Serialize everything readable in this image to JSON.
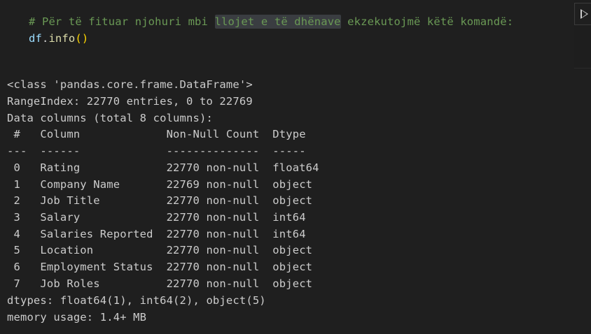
{
  "code_cell": {
    "comment_before": "# Për të fituar njohuri mbi ",
    "comment_highlight": "llojet e të dhënave",
    "comment_after": " ekzekutojmë këtë komandë:",
    "code_var": "df",
    "code_dot": ".",
    "code_fn": "info",
    "code_paren": "()"
  },
  "output_lines": [
    "<class 'pandas.core.frame.DataFrame'>",
    "RangeIndex: 22770 entries, 0 to 22769",
    "Data columns (total 8 columns):",
    " #   Column             Non-Null Count  Dtype  ",
    "---  ------             --------------  -----  ",
    " 0   Rating             22770 non-null  float64",
    " 1   Company Name       22769 non-null  object ",
    " 2   Job Title          22770 non-null  object ",
    " 3   Salary             22770 non-null  int64  ",
    " 4   Salaries Reported  22770 non-null  int64  ",
    " 5   Location           22770 non-null  object ",
    " 6   Employment Status  22770 non-null  object ",
    " 7   Job Roles          22770 non-null  object ",
    "dtypes: float64(1), int64(2), object(5)",
    "memory usage: 1.4+ MB"
  ],
  "icons": {
    "run": "play-icon"
  }
}
